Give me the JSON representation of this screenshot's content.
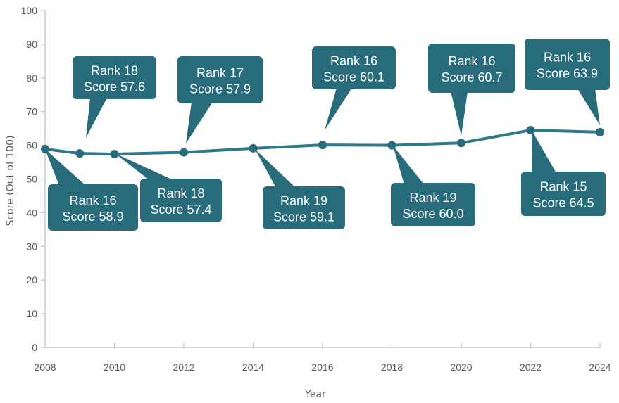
{
  "chart_data": {
    "type": "line",
    "title": "",
    "xlabel": "Year",
    "ylabel": "Score (Out of 100)",
    "xlim": [
      2008,
      2024
    ],
    "ylim": [
      0,
      100
    ],
    "x_ticks": [
      2008,
      2010,
      2012,
      2014,
      2016,
      2018,
      2020,
      2022,
      2024
    ],
    "y_ticks": [
      0,
      10,
      20,
      30,
      40,
      50,
      60,
      70,
      80,
      90,
      100
    ],
    "grid": false,
    "legend": "none",
    "series": [
      {
        "name": "Score",
        "color": "#2e7a8c",
        "points": [
          {
            "x": 2008,
            "y": 58.9,
            "rank": 16
          },
          {
            "x": 2009,
            "y": 57.6,
            "rank": 18
          },
          {
            "x": 2010,
            "y": 57.4,
            "rank": 18
          },
          {
            "x": 2012,
            "y": 57.9,
            "rank": 17
          },
          {
            "x": 2014,
            "y": 59.1,
            "rank": 19
          },
          {
            "x": 2016,
            "y": 60.1,
            "rank": 16
          },
          {
            "x": 2018,
            "y": 60.0,
            "rank": 19
          },
          {
            "x": 2020,
            "y": 60.7,
            "rank": 16
          },
          {
            "x": 2022,
            "y": 64.5,
            "rank": 15
          },
          {
            "x": 2024,
            "y": 63.9,
            "rank": 16
          }
        ]
      }
    ],
    "annotations": [
      {
        "x": 2008,
        "line1": "Rank 16",
        "line2": "Score 58.9",
        "placement": "below"
      },
      {
        "x": 2009,
        "line1": "Rank 18",
        "line2": "Score 57.6",
        "placement": "above"
      },
      {
        "x": 2010,
        "line1": "Rank 18",
        "line2": "Score 57.4",
        "placement": "below"
      },
      {
        "x": 2012,
        "line1": "Rank 17",
        "line2": "Score 57.9",
        "placement": "above"
      },
      {
        "x": 2014,
        "line1": "Rank 19",
        "line2": "Score 59.1",
        "placement": "below"
      },
      {
        "x": 2016,
        "line1": "Rank 16",
        "line2": "Score 60.1",
        "placement": "above"
      },
      {
        "x": 2018,
        "line1": "Rank 19",
        "line2": "Score 60.0",
        "placement": "below"
      },
      {
        "x": 2020,
        "line1": "Rank 16",
        "line2": "Score 60.7",
        "placement": "above"
      },
      {
        "x": 2022,
        "line1": "Rank 15",
        "line2": "Score 64.5",
        "placement": "below"
      },
      {
        "x": 2024,
        "line1": "Rank 16",
        "line2": "Score 63.9",
        "placement": "above"
      }
    ],
    "callout_color": "#286b7b",
    "axis_color": "#bfbfbf"
  }
}
